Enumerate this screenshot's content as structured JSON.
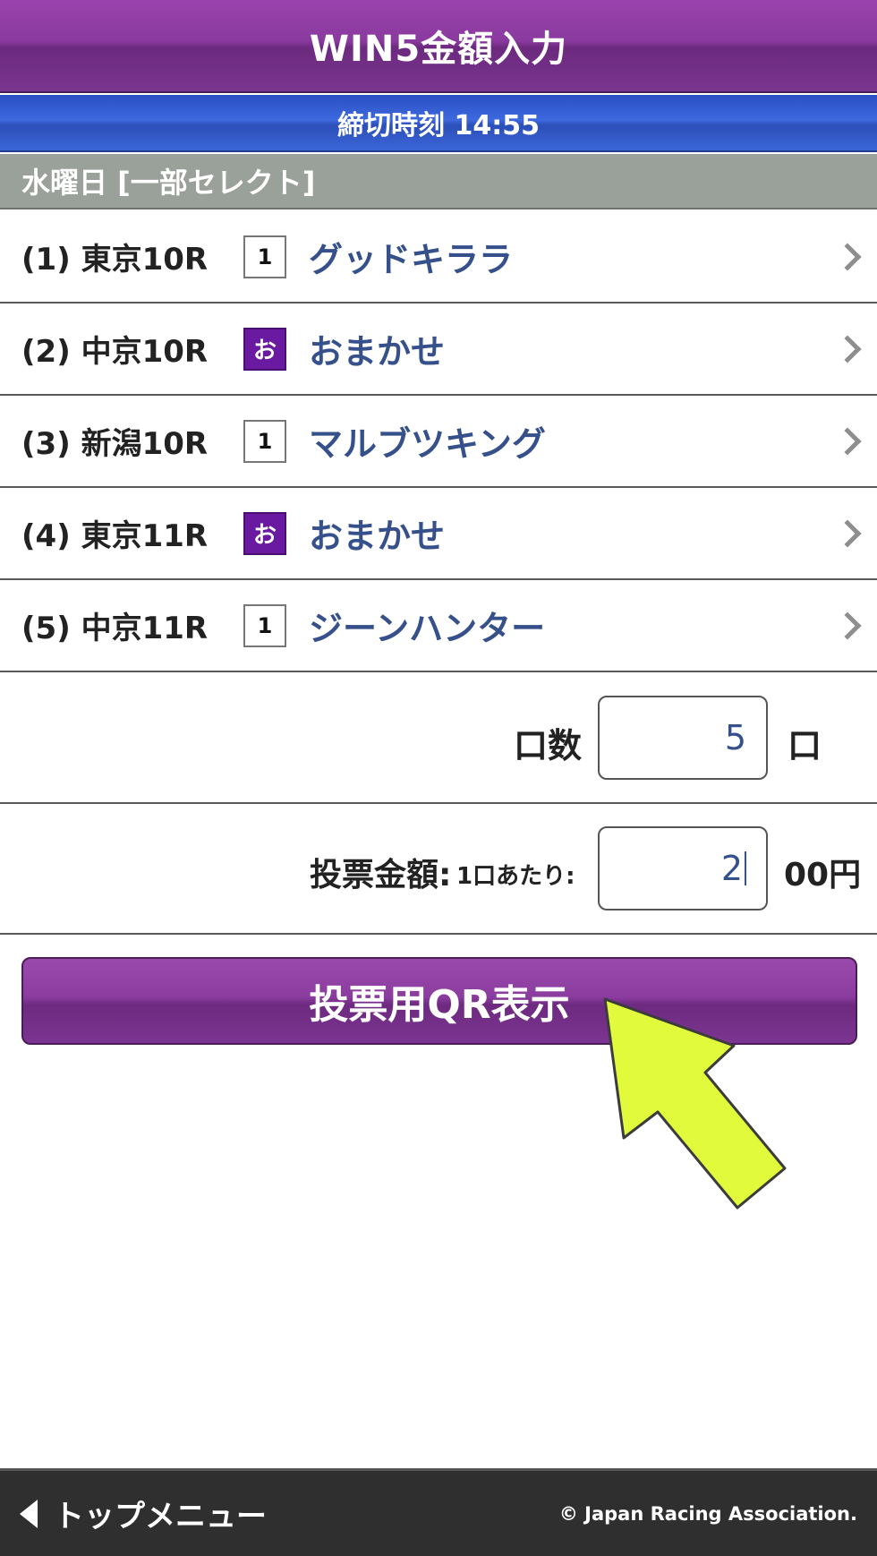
{
  "header": {
    "title": "WIN5金額入力"
  },
  "deadline": {
    "text": "締切時刻 14:55"
  },
  "day": {
    "label": "水曜日 [一部セレクト]"
  },
  "races": [
    {
      "label": "(1) 東京10R",
      "badge": "1",
      "badge_type": "num",
      "horse": "グッドキララ"
    },
    {
      "label": "(2) 中京10R",
      "badge": "お",
      "badge_type": "omakase",
      "horse": "おまかせ"
    },
    {
      "label": "(3) 新潟10R",
      "badge": "1",
      "badge_type": "num",
      "horse": "マルブツキング"
    },
    {
      "label": "(4) 東京11R",
      "badge": "お",
      "badge_type": "omakase",
      "horse": "おまかせ"
    },
    {
      "label": "(5) 中京11R",
      "badge": "1",
      "badge_type": "num",
      "horse": "ジーンハンター"
    }
  ],
  "count": {
    "label": "口数",
    "value": "5",
    "unit": "口"
  },
  "amount": {
    "label": "投票金額:",
    "sublabel": "1口あたり:",
    "value": "2",
    "unit": "00円"
  },
  "qr_button": {
    "label": "投票用QR表示"
  },
  "footer": {
    "back_label": "トップメニュー",
    "copyright": "© Japan Racing Association."
  },
  "colors": {
    "purple": "#8b3d9f",
    "blue": "#3d69de",
    "gray": "#9aa09a",
    "link": "#35508a",
    "pointer": "#e2fa3c"
  }
}
